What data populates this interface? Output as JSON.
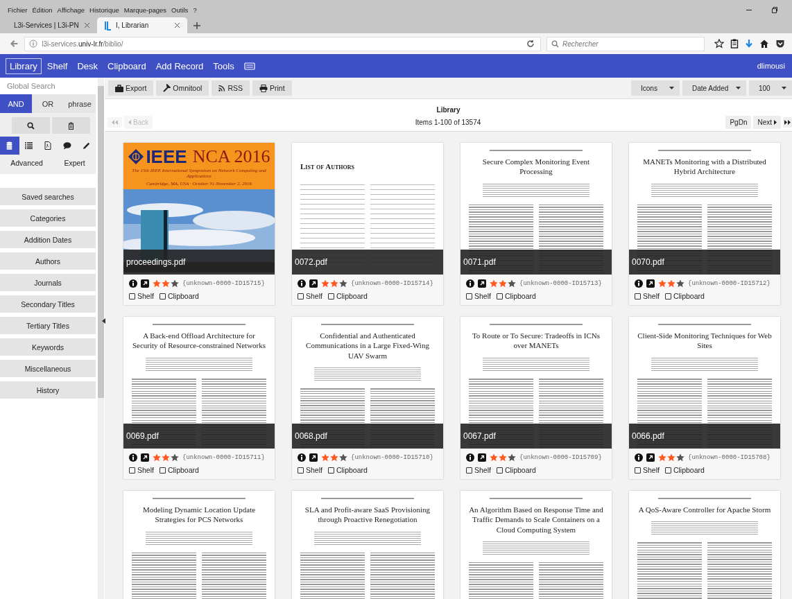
{
  "browser": {
    "menu": [
      "Fichier",
      "Édition",
      "Affichage",
      "Historique",
      "Marque-pages",
      "Outils",
      "?"
    ],
    "tabs": [
      {
        "label": "L3i-Services | L3i-PN",
        "selected": false
      },
      {
        "label": "I, Librarian",
        "selected": true
      }
    ],
    "url": {
      "prefix": "l3i-services.",
      "domain": "univ-lr.fr",
      "path": "/biblio/"
    },
    "search": {
      "placeholder": "Rechercher"
    }
  },
  "navbar": {
    "items": [
      {
        "label": "Library",
        "selected": true
      },
      {
        "label": "Shelf",
        "selected": false
      },
      {
        "label": "Desk",
        "selected": false
      },
      {
        "label": "Clipboard",
        "selected": false
      },
      {
        "label": "Add Record",
        "selected": false
      },
      {
        "label": "Tools",
        "selected": false
      }
    ],
    "user": "dlimousi"
  },
  "sidebar": {
    "search": {
      "placeholder": "Global Search"
    },
    "modes": [
      {
        "label": "AND",
        "selected": true
      },
      {
        "label": "OR",
        "selected": false
      },
      {
        "label": "phrase",
        "selected": false
      }
    ],
    "scopes": [
      {
        "kind": "database",
        "selected": true
      },
      {
        "kind": "list",
        "selected": false
      },
      {
        "kind": "pdf",
        "selected": false
      },
      {
        "kind": "comment",
        "selected": false
      },
      {
        "kind": "pencil",
        "selected": false
      }
    ],
    "search_types": [
      "Advanced",
      "Expert"
    ],
    "sections": [
      "Saved searches",
      "Categories",
      "Addition Dates",
      "Authors",
      "Journals",
      "Secondary Titles",
      "Tertiary Titles",
      "Keywords",
      "Miscellaneous",
      "History"
    ]
  },
  "toolbar": {
    "buttons": [
      {
        "kind": "export",
        "label": "Export"
      },
      {
        "kind": "omnitool",
        "label": "Omnitool"
      },
      {
        "kind": "rss",
        "label": "RSS"
      },
      {
        "kind": "print",
        "label": "Print"
      }
    ],
    "selects": [
      "Icons",
      "Date Added",
      "100"
    ]
  },
  "library": {
    "title": "Library",
    "count": "Items 1-100 of 13574",
    "back": "Back",
    "pgdn": "PgDn",
    "next": "Next"
  },
  "items": [
    {
      "file": "proceedings.pdf",
      "id": "{unknown-0000-ID15715}",
      "stars": 2,
      "shelf": {
        "label": "Shelf",
        "checked": false
      },
      "clipboard": {
        "label": "Clipboard",
        "checked": false
      },
      "thumb": {
        "kind": "cover",
        "logo": "IEEE",
        "title": "NCA 2016",
        "subtitle": "The 15th IEEE International Symposium on Network Computing and Applications",
        "place": "Cambridge, MA, USA · October 31-November 2, 2016"
      }
    },
    {
      "file": "0072.pdf",
      "id": "{unknown-0000-ID15714}",
      "stars": 2,
      "shelf": {
        "label": "Shelf",
        "checked": false
      },
      "clipboard": {
        "label": "Clipboard",
        "checked": false
      },
      "thumb": {
        "kind": "authors",
        "title": "List of Authors"
      }
    },
    {
      "file": "0071.pdf",
      "id": "{unknown-0000-ID15713}",
      "stars": 2,
      "shelf": {
        "label": "Shelf",
        "checked": false
      },
      "clipboard": {
        "label": "Clipboard",
        "checked": false
      },
      "thumb": {
        "kind": "paper",
        "title": "Secure Complex Monitoring Event Processing"
      }
    },
    {
      "file": "0070.pdf",
      "id": "{unknown-0000-ID15712}",
      "stars": 2,
      "shelf": {
        "label": "Shelf",
        "checked": false
      },
      "clipboard": {
        "label": "Clipboard",
        "checked": false
      },
      "thumb": {
        "kind": "paper",
        "title": "MANETs Monitoring with a Distributed Hybrid Architecture"
      }
    },
    {
      "file": "0069.pdf",
      "id": "{unknown-0000-ID15711}",
      "stars": 2,
      "shelf": {
        "label": "Shelf",
        "checked": false
      },
      "clipboard": {
        "label": "Clipboard",
        "checked": false
      },
      "thumb": {
        "kind": "paper",
        "title": "A Back-end Offload Architecture for Security of Resource-constrained Networks"
      }
    },
    {
      "file": "0068.pdf",
      "id": "{unknown-0000-ID15710}",
      "stars": 2,
      "shelf": {
        "label": "Shelf",
        "checked": false
      },
      "clipboard": {
        "label": "Clipboard",
        "checked": false
      },
      "thumb": {
        "kind": "paper",
        "title": "Confidential and Authenticated Communications in a Large Fixed-Wing UAV Swarm"
      }
    },
    {
      "file": "0067.pdf",
      "id": "{unknown-0000-ID15709}",
      "stars": 2,
      "shelf": {
        "label": "Shelf",
        "checked": false
      },
      "clipboard": {
        "label": "Clipboard",
        "checked": false
      },
      "thumb": {
        "kind": "paper",
        "title": "To Route or To Secure: Tradeoffs in ICNs over MANETs"
      }
    },
    {
      "file": "0066.pdf",
      "id": "{unknown-0000-ID15708}",
      "stars": 2,
      "shelf": {
        "label": "Shelf",
        "checked": false
      },
      "clipboard": {
        "label": "Clipboard",
        "checked": false
      },
      "thumb": {
        "kind": "paper",
        "title": "Client-Side Monitoring Techniques for Web Sites"
      }
    },
    {
      "thumb": {
        "kind": "paper",
        "title": "Modeling Dynamic Location Update Strategies for PCS Networks"
      }
    },
    {
      "thumb": {
        "kind": "paper",
        "title": "SLA and Profit-aware SaaS Provisioning through Proactive Renegotiation"
      }
    },
    {
      "thumb": {
        "kind": "paper",
        "title": "An Algorithm Based on Response Time and Traffic Demands to Scale Containers on a Cloud Computing System"
      }
    },
    {
      "thumb": {
        "kind": "paper",
        "title": "A QoS-Aware Controller for Apache Storm"
      }
    }
  ]
}
